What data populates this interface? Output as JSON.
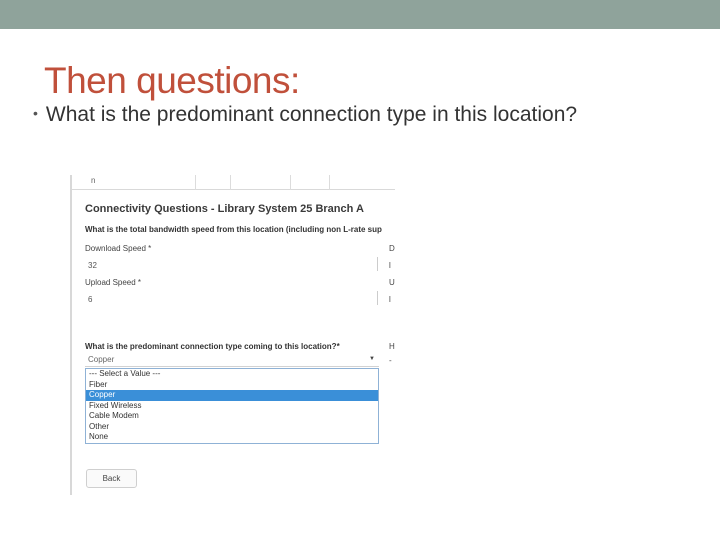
{
  "slide": {
    "title": "Then questions:",
    "bullet": "What is the predominant connection type in this location?"
  },
  "form": {
    "table_row_text": "n",
    "header": "Connectivity Questions - Library System 25 Branch A",
    "bandwidth_question": "What is the total bandwidth speed from this location (including non L-rate sup",
    "download_label": "Download Speed *",
    "download_value": "32",
    "upload_label": "Upload Speed *",
    "upload_value": "6",
    "right_fragments": {
      "d1": "D",
      "d2": "l",
      "u1": "U",
      "u2": "l",
      "h": "H",
      "h2": "-"
    },
    "connection_question": "What is the predominant connection type coming to this location?*",
    "connection_selected": "Copper",
    "caret": "▼",
    "options": [
      "--- Select a Value ---",
      "Fiber",
      "Copper",
      "Fixed Wireless",
      "Cable Modem",
      "Other",
      "None"
    ],
    "selected_option_index": 2,
    "back_label": "Back"
  }
}
